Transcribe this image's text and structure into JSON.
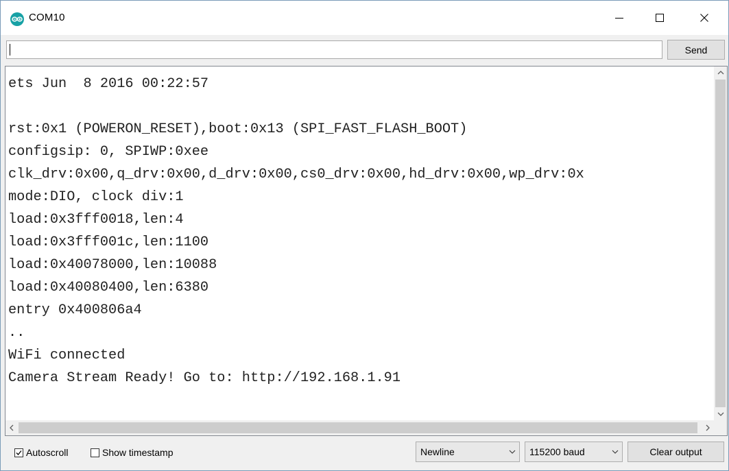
{
  "window": {
    "title": "COM10",
    "app_icon": "arduino-logo-icon",
    "controls": {
      "minimize_icon": "minimize-icon",
      "maximize_icon": "maximize-icon",
      "close_icon": "close-icon"
    }
  },
  "send_row": {
    "input_value": "",
    "send_label": "Send"
  },
  "output": {
    "lines": [
      "ets Jun  8 2016 00:22:57",
      "",
      "rst:0x1 (POWERON_RESET),boot:0x13 (SPI_FAST_FLASH_BOOT)",
      "configsip: 0, SPIWP:0xee",
      "clk_drv:0x00,q_drv:0x00,d_drv:0x00,cs0_drv:0x00,hd_drv:0x00,wp_drv:0x",
      "mode:DIO, clock div:1",
      "load:0x3fff0018,len:4",
      "load:0x3fff001c,len:1100",
      "load:0x40078000,len:10088",
      "load:0x40080400,len:6380",
      "entry 0x400806a4",
      "..",
      "WiFi connected",
      "Camera Stream Ready! Go to: http://192.168.1.91",
      ""
    ]
  },
  "bottom_bar": {
    "autoscroll_label": "Autoscroll",
    "autoscroll_checked": true,
    "timestamp_label": "Show timestamp",
    "timestamp_checked": false,
    "line_ending": "Newline",
    "baud_rate": "115200 baud",
    "clear_label": "Clear output"
  },
  "colors": {
    "icon_teal": "#17a1a5",
    "window_bg": "#f0f0f0",
    "output_bg": "#ffffff"
  }
}
